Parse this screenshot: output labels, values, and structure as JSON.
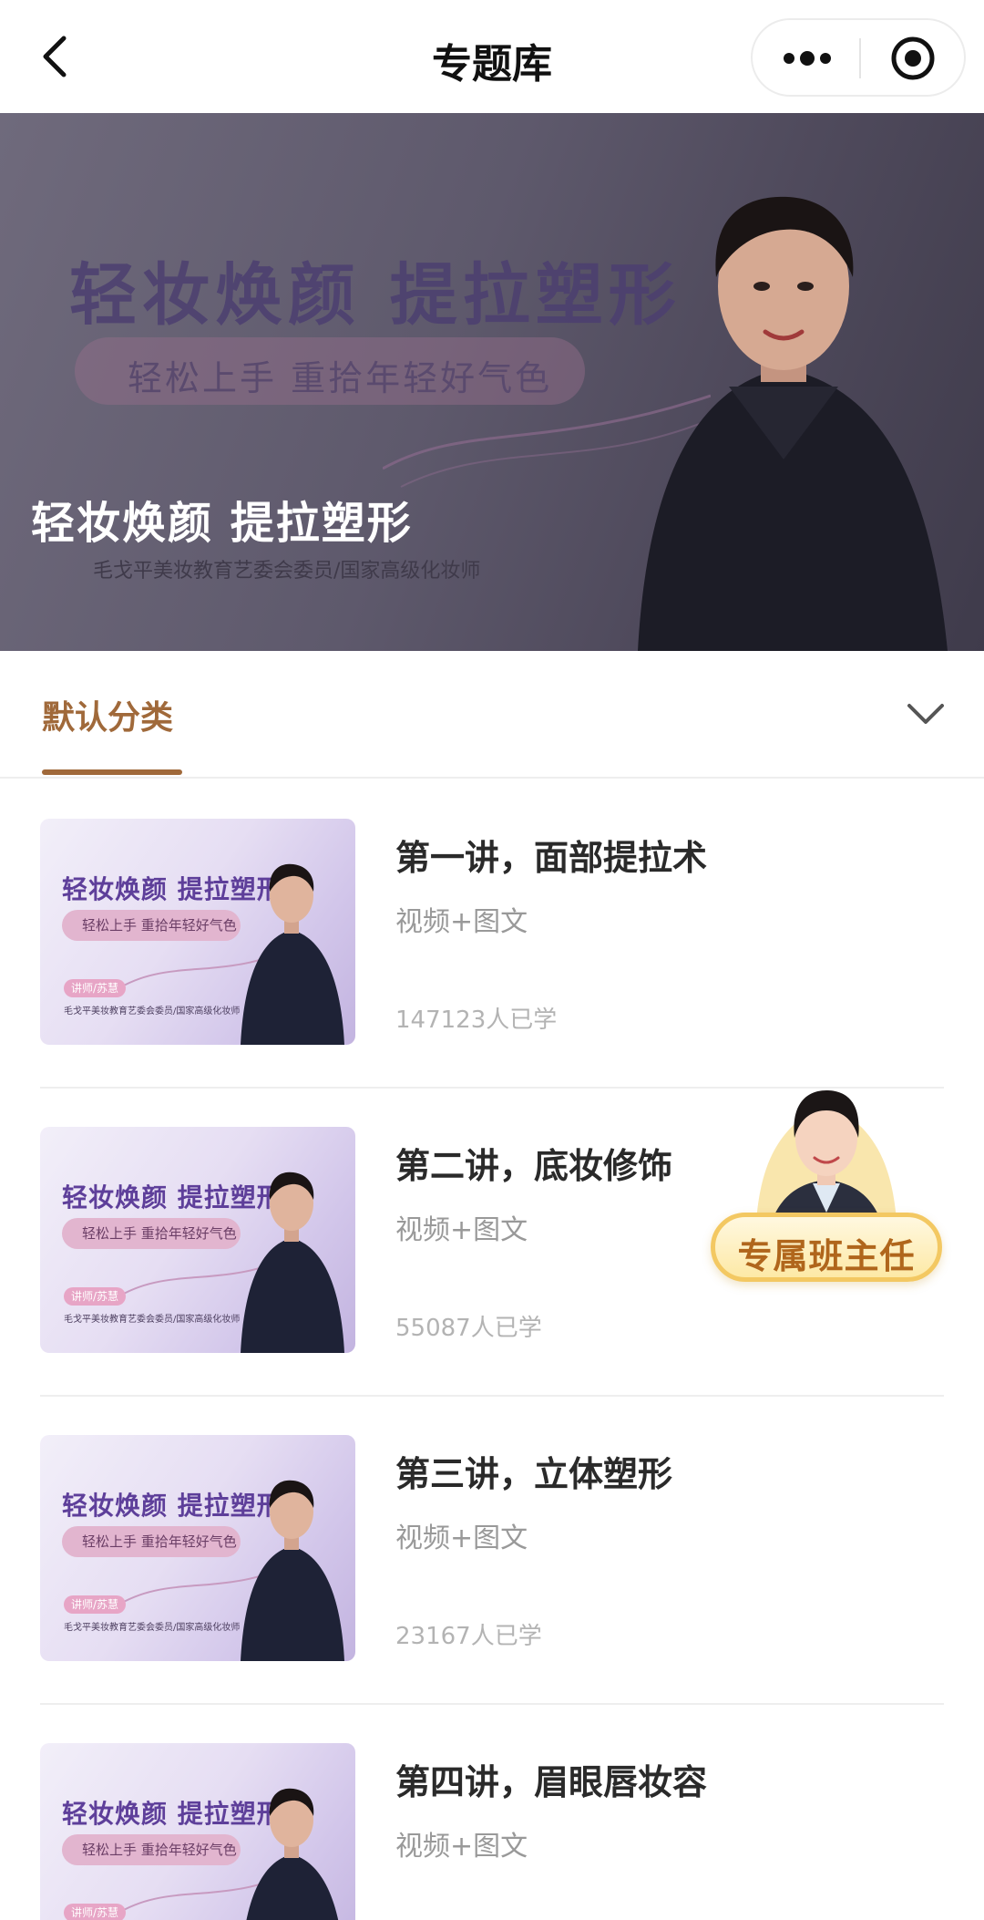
{
  "navbar": {
    "title": "专题库"
  },
  "banner": {
    "bg_title": "轻妆焕颜 提拉塑形",
    "bg_subtitle": "轻松上手 重拾年轻好气色",
    "title": "轻妆焕颜 提拉塑形",
    "description": "毛戈平美妆教育艺委会委员/国家高级化妆师"
  },
  "tabs": {
    "active_label": "默认分类"
  },
  "thumbnail": {
    "title": "轻妆焕颜 提拉塑形",
    "subtitle": "轻松上手 重拾年轻好气色",
    "tag": "讲师/苏慧",
    "desc": "毛戈平美妆教育艺委会委员/国家高级化妆师"
  },
  "lessons": [
    {
      "title": "第一讲，面部提拉术",
      "type": "视频+图文",
      "learners": "147123人已学"
    },
    {
      "title": "第二讲，底妆修饰",
      "type": "视频+图文",
      "learners": "55087人已学"
    },
    {
      "title": "第三讲，立体塑形",
      "type": "视频+图文",
      "learners": "23167人已学"
    },
    {
      "title": "第四讲，眉眼唇妆容",
      "type": "视频+图文",
      "learners": ""
    }
  ],
  "advisor": {
    "label": "专属班主任"
  },
  "colors": {
    "accent": "#a0693a",
    "advisor_text": "#b0661c",
    "advisor_border": "#f3c862"
  }
}
